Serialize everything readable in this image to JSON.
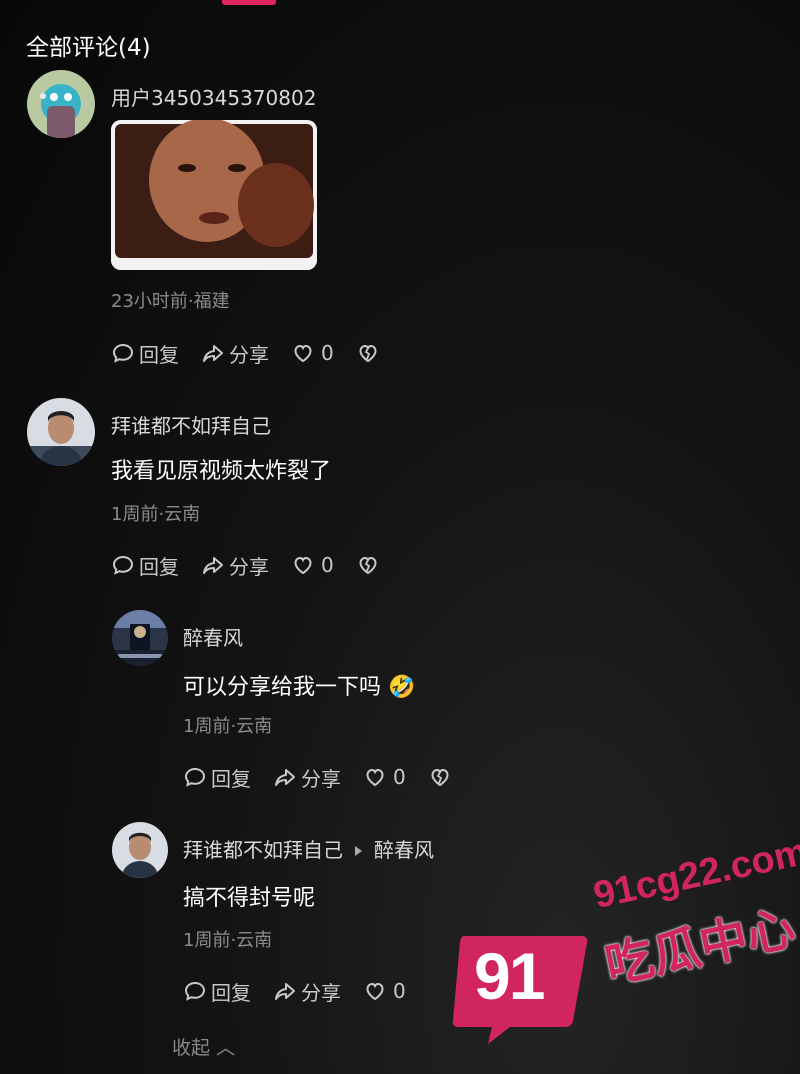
{
  "section_title": "全部评论(4)",
  "comments": [
    {
      "username": "用户3450345370802",
      "content": "",
      "meta": "23小时前·福建",
      "reply_label": "回复",
      "share_label": "分享",
      "likes": "0"
    },
    {
      "username": "拜谁都不如拜自己",
      "content": "我看见原视频太炸裂了",
      "meta": "1周前·云南",
      "reply_label": "回复",
      "share_label": "分享",
      "likes": "0"
    },
    {
      "username": "醉春风",
      "content": "可以分享给我一下吗",
      "emoji": "🤣",
      "meta": "1周前·云南",
      "reply_label": "回复",
      "share_label": "分享",
      "likes": "0"
    },
    {
      "username": "拜谁都不如拜自己",
      "reply_to": "醉春风",
      "content": "搞不得封号呢",
      "meta": "1周前·云南",
      "reply_label": "回复",
      "share_label": "分享",
      "likes": "0"
    }
  ],
  "collapse_label": "收起",
  "watermark": {
    "number": "91",
    "url": "91cg22.com",
    "name": "吃瓜中心"
  },
  "colors": {
    "accent": "#e0245e",
    "watermark": "#d0265d",
    "secondary_text": "#8b8b8b"
  }
}
